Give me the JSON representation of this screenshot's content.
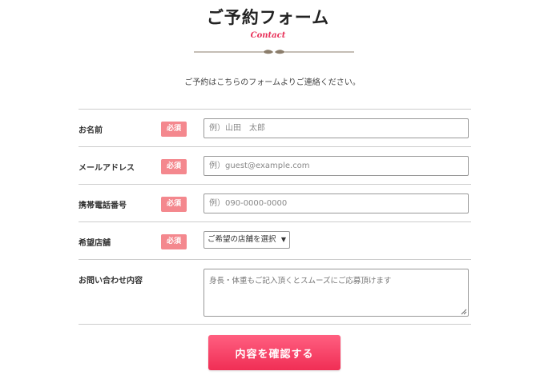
{
  "header": {
    "title": "ご予約フォーム",
    "subtitle": "Contact",
    "intro": "ご予約はこちらのフォームよりご連絡ください。"
  },
  "form": {
    "required_badge": "必須",
    "name": {
      "label": "お名前",
      "placeholder": "例）山田　太郎"
    },
    "email": {
      "label": "メールアドレス",
      "placeholder": "例）guest@example.com"
    },
    "phone": {
      "label": "携帯電話番号",
      "placeholder": "例）090-0000-0000"
    },
    "store": {
      "label": "希望店舗",
      "selected": "ご希望の店舗を選択"
    },
    "message": {
      "label": "お問い合わせ内容",
      "placeholder": "身長・体重もご記入頂くとスムーズにご応募頂けます"
    },
    "submit_label": "内容を確認する"
  },
  "colors": {
    "accent": "#f02e55",
    "badge": "#f4888e",
    "subtitle": "#e8325a"
  },
  "icons": {
    "ornament": "divider-ornament-icon",
    "select_caret": "caret-down-icon",
    "resize": "resize-grip-icon"
  }
}
